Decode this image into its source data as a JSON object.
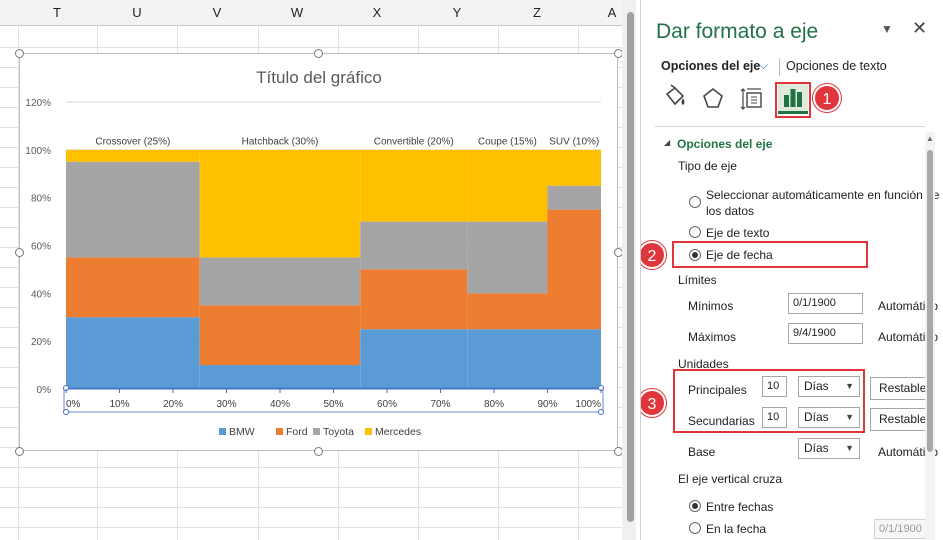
{
  "sheet": {
    "columns": [
      "T",
      "U",
      "V",
      "W",
      "X",
      "Y",
      "Z",
      "A"
    ]
  },
  "chart_data": {
    "type": "area",
    "subtype": "marimekko",
    "title": "Título del gráfico",
    "yticks": [
      "0%",
      "20%",
      "40%",
      "60%",
      "80%",
      "100%",
      "120%"
    ],
    "xticks": [
      "0%",
      "10%",
      "20%",
      "30%",
      "40%",
      "50%",
      "60%",
      "70%",
      "80%",
      "90%",
      "100%"
    ],
    "ylim": [
      0,
      120
    ],
    "xlim": [
      0,
      100
    ],
    "grid": true,
    "legend_position": "bottom",
    "segments": [
      {
        "label": "Crossover (25%)",
        "x_start": 0,
        "x_end": 25
      },
      {
        "label": "Hatchback (30%)",
        "x_start": 25,
        "x_end": 55
      },
      {
        "label": "Convertible (20%)",
        "x_start": 55,
        "x_end": 75
      },
      {
        "label": "Coupe (15%)",
        "x_start": 75,
        "x_end": 90
      },
      {
        "label": "SUV (10%)",
        "x_start": 90,
        "x_end": 100
      }
    ],
    "series": [
      {
        "name": "BMW",
        "color": "#5b9bd5",
        "values": [
          30,
          10,
          25,
          25,
          25
        ]
      },
      {
        "name": "Ford",
        "color": "#ed7d31",
        "values": [
          25,
          25,
          25,
          15,
          50
        ]
      },
      {
        "name": "Toyota",
        "color": "#a5a5a5",
        "values": [
          40,
          20,
          20,
          30,
          10
        ]
      },
      {
        "name": "Mercedes",
        "color": "#ffc000",
        "values": [
          5,
          45,
          30,
          30,
          15
        ]
      }
    ]
  },
  "pane": {
    "title": "Dar formato a eje",
    "tab_axis": "Opciones del eje",
    "tab_text": "Opciones de texto",
    "callouts": [
      "1",
      "2",
      "3"
    ],
    "section_title": "Opciones del eje",
    "axis_type_label": "Tipo de eje",
    "radio_auto_line1": "Seleccionar automáticamente en función de",
    "radio_auto_line2": "los datos",
    "radio_text_axis": "Eje de texto",
    "radio_date_axis": "Eje de fecha",
    "axis_type_selected": "Eje de fecha",
    "limits_label": "Límites",
    "min_label": "Mínimos",
    "min_value": "0/1/1900",
    "min_auto": "Automático",
    "max_label": "Máximos",
    "max_value": "9/4/1900",
    "max_auto": "Automático",
    "units_label": "Unidades",
    "major_label": "Principales",
    "major_value": "10",
    "major_unit": "Días",
    "major_reset": "Restablecer",
    "minor_label": "Secundarias",
    "minor_value": "10",
    "minor_unit": "Días",
    "minor_reset": "Restablecer",
    "base_label": "Base",
    "base_unit": "Días",
    "base_auto": "Automático",
    "cross_label": "El eje vertical cruza",
    "radio_between_dates": "Entre fechas",
    "radio_on_date": "En la fecha",
    "on_date_value": "0/1/1900",
    "cross_selected": "Entre fechas"
  }
}
